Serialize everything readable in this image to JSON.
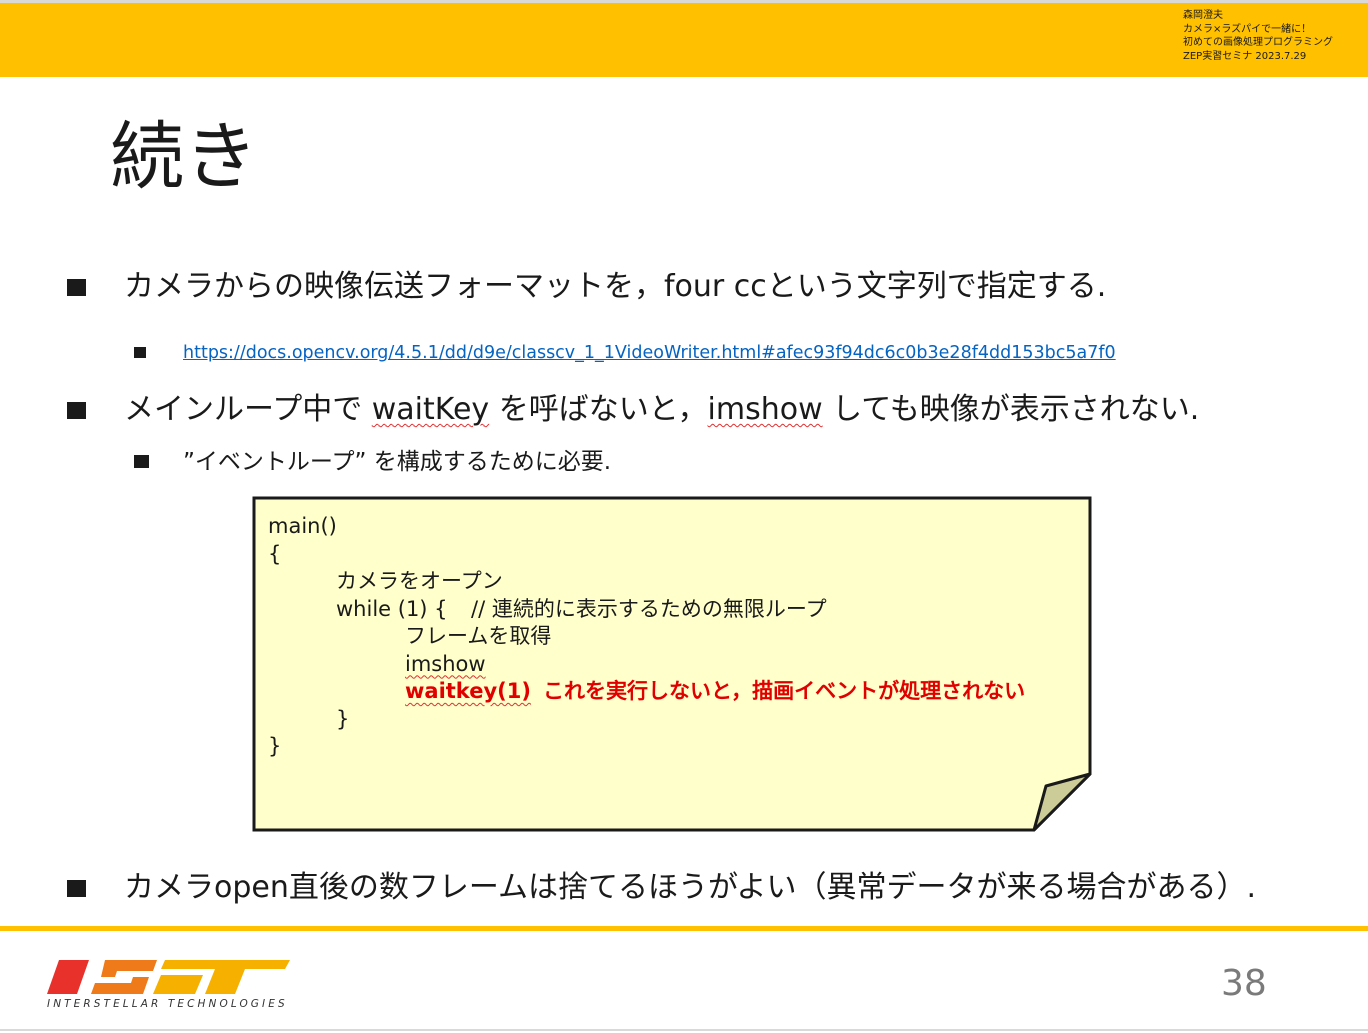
{
  "header": {
    "meta_lines": [
      "森岡澄夫",
      "カメラ×ラズパイで一緒に！",
      "初めての画像処理プログラミング",
      "ZEP実習セミナ 2023.7.29"
    ],
    "band_color": "#ffc000"
  },
  "slide": {
    "title": "続き",
    "bullets": {
      "b1": {
        "text": "カメラからの映像伝送フォーマットを，four ccという文字列で指定する.",
        "sub_link": "https://docs.opencv.org/4.5.1/dd/d9e/classcv_1_1VideoWriter.html#afec93f94dc6c0b3e28f4dd153bc5a7f0"
      },
      "b2": {
        "part1": "メインループ中で ",
        "code1": "waitKey",
        "part2": " を呼ばないと，",
        "code2": "imshow",
        "part3": " しても映像が表示されない.",
        "sub": "”イベントループ” を構成するために必要."
      },
      "b3": {
        "text": "カメラopen直後の数フレームは捨てるほうがよい（異常データが来る場合がある）."
      }
    },
    "code_note": {
      "lines": {
        "l1": "main()",
        "l2": "{",
        "l3": "カメラをオープン",
        "l4a": "while (1) {",
        "l4b": "// 連続的に表示するための無限ループ",
        "l5": "フレームを取得",
        "l6": "imshow",
        "l7a": "waitkey(1)",
        "l7b": "これを実行しないと，描画イベントが処理されない",
        "l8": "}",
        "l9": "}"
      },
      "fill_color": "#ffffcc",
      "highlight_color": "#e00000"
    }
  },
  "footer": {
    "logo_text": "INTERSTELLAR TECHNOLOGIES",
    "page_number": "38",
    "line_color": "#ffc000"
  }
}
